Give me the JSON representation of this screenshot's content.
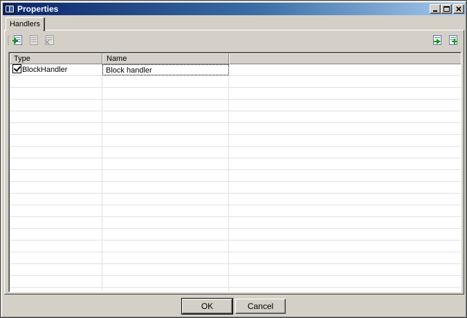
{
  "window": {
    "title": "Properties"
  },
  "tabs": [
    {
      "label": "Handlers",
      "active": true
    }
  ],
  "toolbar": {
    "left_tools": [
      {
        "icon": "add-handler-icon",
        "enabled": true
      },
      {
        "icon": "properties-icon",
        "enabled": false
      },
      {
        "icon": "delete-icon",
        "enabled": false
      }
    ],
    "right_tools": [
      {
        "icon": "export-icon",
        "enabled": true
      },
      {
        "icon": "add-row-icon",
        "enabled": true
      }
    ]
  },
  "grid": {
    "columns": [
      "Type",
      "Name",
      ""
    ],
    "rows": [
      {
        "checked": true,
        "type": "BlockHandler",
        "name": "Block handler"
      }
    ]
  },
  "buttons": {
    "ok": "OK",
    "cancel": "Cancel"
  }
}
